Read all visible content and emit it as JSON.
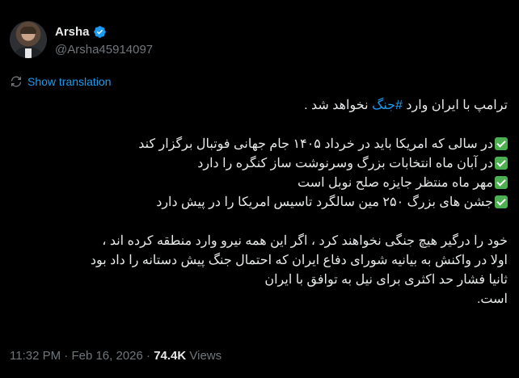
{
  "author": {
    "name": "Arsha",
    "handle": "@Arsha45914097",
    "verified_color": "#1d9bf0"
  },
  "translate_label": "Show translation",
  "tweet": {
    "line1_before": "ترامپ با ایران وارد ",
    "line1_hashtag": "#جنگ",
    "line1_after": " نخواهد شد .",
    "bullets": [
      "در سالی که امریکا باید در خرداد ۱۴۰۵ جام جهانی فوتبال برگزار کند",
      "در آبان ماه انتخابات بزرگ وسرنوشت ساز کنگره را دارد",
      "مهر ماه منتظر جایزه صلح نوبل است",
      "جشن های بزرگ ۲۵۰ مین سالگرد تاسیس امریکا را در پیش دارد"
    ],
    "paragraph": [
      "خود را درگیر هیچ جنگی نخواهند کرد ، اگر این همه نیرو وارد منطقه کرده اند ،",
      "اولا در واکنش به بیانیه شورای دفاع ایران که احتمال جنگ پیش دستانه را داد بود",
      "ثانیا فشار حد اکثری برای نیل به توافق با ایران",
      "است."
    ]
  },
  "meta": {
    "time": "11:32 PM",
    "separator": " · ",
    "date": "Feb 16, 2026",
    "views_count": "74.4K",
    "views_label": " Views"
  }
}
